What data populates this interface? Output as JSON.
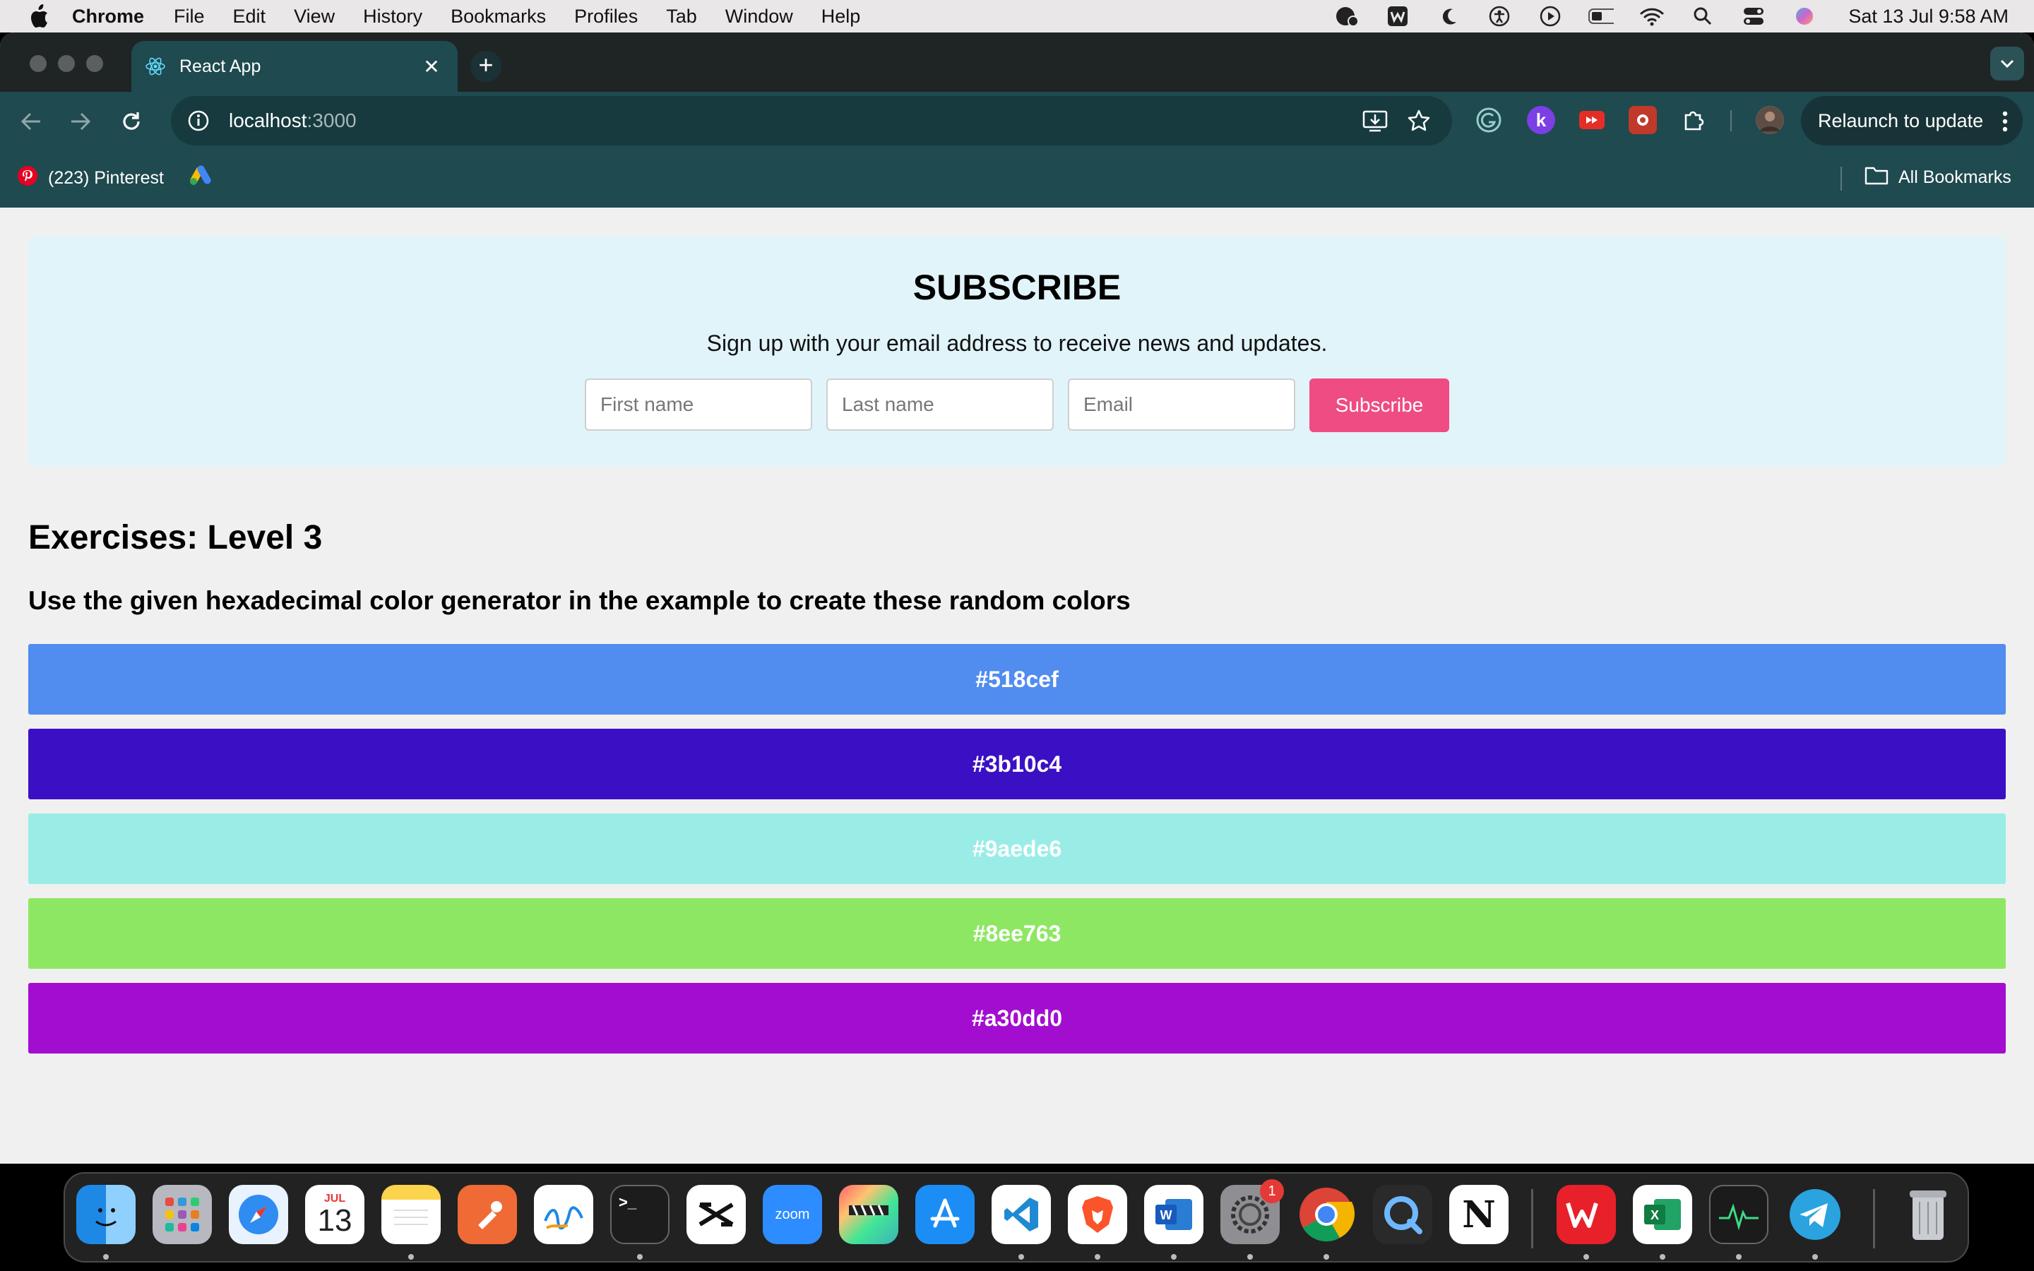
{
  "menubar": {
    "app_name": "Chrome",
    "items": [
      "File",
      "Edit",
      "View",
      "History",
      "Bookmarks",
      "Profiles",
      "Tab",
      "Window",
      "Help"
    ],
    "clock": "Sat 13 Jul  9:58 AM"
  },
  "browser": {
    "tab_title": "React App",
    "url_host": "localhost",
    "url_port": ":3000",
    "relaunch_label": "Relaunch to update",
    "bookmarks": [
      {
        "label": "(223) Pinterest"
      }
    ],
    "all_bookmarks_label": "All Bookmarks"
  },
  "subscribe": {
    "title": "SUBSCRIBE",
    "subtitle": "Sign up with your email address to receive news and updates.",
    "first_name_placeholder": "First name",
    "last_name_placeholder": "Last name",
    "email_placeholder": "Email",
    "button_label": "Subscribe"
  },
  "exercise": {
    "title": "Exercises: Level 3",
    "description": "Use the given hexadecimal color generator in the example to create these random colors",
    "colors": [
      "#518cef",
      "#3b10c4",
      "#9aede6",
      "#8ee763",
      "#a30dd0"
    ]
  },
  "dock": {
    "calendar_month": "JUL",
    "calendar_day": "13",
    "settings_badge": "1"
  }
}
